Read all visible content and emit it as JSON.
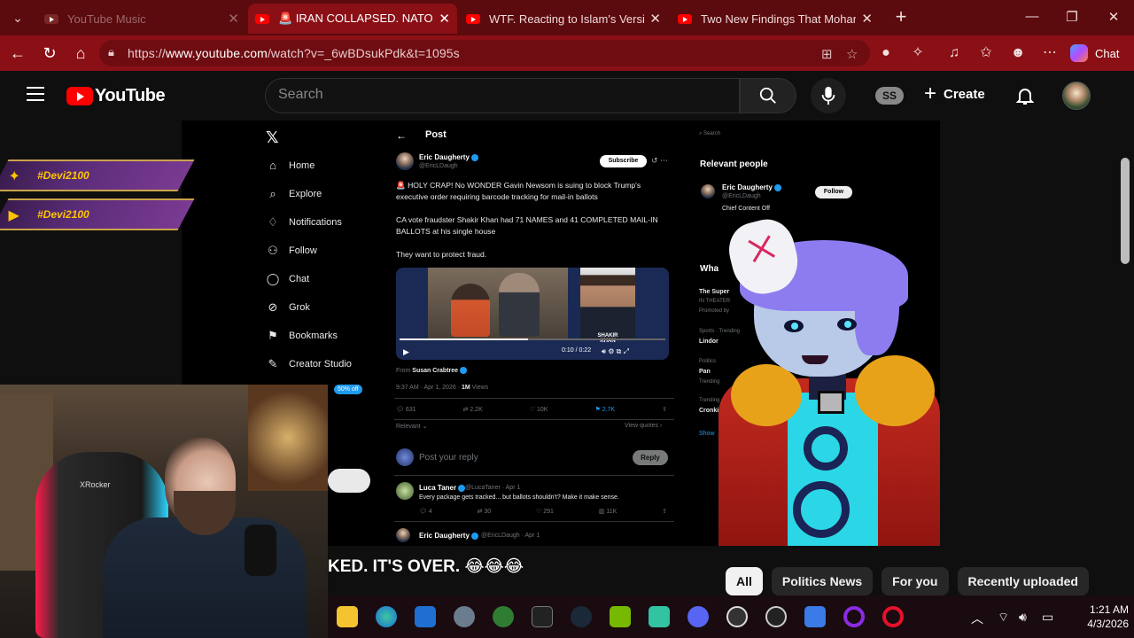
{
  "browser": {
    "tabs": [
      {
        "label": "YouTube Music",
        "state": "inactive"
      },
      {
        "label": "🚨 IRAN COLLAPSED. NATO IS F*",
        "state": "active"
      },
      {
        "label": "WTF. Reacting to Islam's Version o",
        "state": "inactive"
      },
      {
        "label": "Two New Findings That Mohamm",
        "state": "inactive"
      }
    ],
    "url_prefix": "https://",
    "url_host": "www.youtube.com",
    "url_path": "/watch?v=_6wBDsukPdk&t=1095s",
    "chat_label": "Chat",
    "accent": "#8a1016",
    "tabstrip_color": "#5b0a0e"
  },
  "youtube": {
    "logo_text": "YouTube",
    "search_placeholder": "Search",
    "profile_badge": "SS",
    "create_label": "Create"
  },
  "x_post": {
    "nav": [
      {
        "icon": "home-icon",
        "label": "Home"
      },
      {
        "icon": "explore-icon",
        "label": "Explore"
      },
      {
        "icon": "notifications-icon",
        "label": "Notifications"
      },
      {
        "icon": "follow-icon",
        "label": "Follow"
      },
      {
        "icon": "chat-icon",
        "label": "Chat"
      },
      {
        "icon": "grok-icon",
        "label": "Grok"
      },
      {
        "icon": "bookmarks-icon",
        "label": "Bookmarks"
      },
      {
        "icon": "creator-studio-icon",
        "label": "Creator Studio"
      }
    ],
    "promo_badge": "50% off",
    "header": "Post",
    "author_name": "Eric Daugherty",
    "author_handle": "@EricLDaugh",
    "subscribe_label": "Subscribe",
    "text_1": "🚨 HOLY CRAP! No WONDER Gavin Newsom is suing to block Trump's executive order requiring barcode tracking for mail-in ballots",
    "text_2": "CA vote fraudster Shakir Khan had 71 NAMES and 41 COMPLETED MAIL-IN BALLOTS at his single house",
    "text_3": "They want to protect fraud.",
    "video_caption_1": "SHAKIR",
    "video_caption_2": "KHAN",
    "video_time": "0:10 / 0:22",
    "from_prefix": "From",
    "from_name": "Susan Crabtree",
    "timestamp": "9:37 AM · Apr 1, 2026 ·",
    "views": "1M",
    "views_suffix": "Views",
    "stats": {
      "replies": "631",
      "reposts": "2.2K",
      "likes": "10K",
      "bookmarks": "2.7K"
    },
    "relevant_label": "Relevant ⌄",
    "view_quotes": "View quotes ›",
    "reply_placeholder": "Post your reply",
    "reply_button": "Reply",
    "reply1": {
      "name": "Luca Taner",
      "handle": "@LucaTaner · Apr 1",
      "text": "Every package gets tracked... but ballots shouldn't? Make it make sense.",
      "stats": {
        "replies": "4",
        "reposts": "30",
        "likes": "291",
        "views": "11K"
      }
    },
    "reply2": {
      "name": "Eric Daugherty",
      "handle": "@EricLDaugh · Apr 1"
    },
    "right": {
      "search": "Search",
      "relevant_title": "Relevant people",
      "person_name": "Eric Daugherty",
      "person_handle": "@EricLDaugh",
      "follow_label": "Follow",
      "person_bio": "Chief Content Off",
      "whats_happening": "Wha",
      "t1": "The Super",
      "t1b": "IN THEATER",
      "t1c": "Promoted by",
      "t2a": "Sports · Trending",
      "t2": "Lindor",
      "t3a": "Politics",
      "t3": "Pan",
      "t3b": "Trending",
      "t4a": "Trending",
      "t4": "Cronki",
      "show": "Show"
    }
  },
  "overlays": {
    "banner_text": "#Devi2100",
    "ticker_text": "KED. IT'S OVER. 😂😂😂"
  },
  "chips": [
    "All",
    "Politics News",
    "For you",
    "Recently uploaded"
  ],
  "chip_selected": "All",
  "webcam": {
    "chair_brand": "XRocker"
  },
  "taskbar": {
    "time": "1:21 AM",
    "date": "4/3/2026",
    "apps": [
      "file-explorer-icon",
      "edge-icon",
      "outlook-icon",
      "settings-icon",
      "xbox-icon",
      "epic-games-icon",
      "steam-icon",
      "nvidia-icon",
      "streamlabs-icon",
      "discord-icon",
      "obs-icon",
      "speedometer-icon",
      "melt-icon",
      "circle-app-icon",
      "opera-icon"
    ]
  }
}
